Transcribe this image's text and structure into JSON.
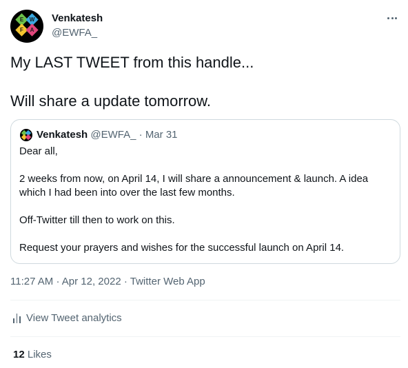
{
  "author": {
    "name": "Venkatesh",
    "handle": "@EWFA_",
    "avatar_letters": [
      "E",
      "W",
      "F",
      "A"
    ]
  },
  "tweet": {
    "lines": [
      "My LAST TWEET from this handle...",
      "Will share a update tomorrow."
    ]
  },
  "quoted_tweet": {
    "name": "Venkatesh",
    "handle": "@EWFA_",
    "separator": "·",
    "date": "Mar 31",
    "paragraphs": [
      "Dear all,",
      "2 weeks from now, on April 14, I will share a announcement & launch. A idea which I had been into over the last few months.",
      "Off-Twitter till then to work on this.",
      "Request your prayers and wishes for the successful launch on April 14."
    ]
  },
  "meta": {
    "time": "11:27 AM",
    "separator": "·",
    "date": "Apr 12, 2022",
    "source": "Twitter Web App"
  },
  "analytics": {
    "label": "View Tweet analytics"
  },
  "engagement": {
    "likes_count": "12",
    "likes_label": "Likes"
  },
  "colors": {
    "text": "#0f1419",
    "secondary": "#536471",
    "border": "#cfd9de",
    "divider": "#eff3f4"
  },
  "icons": {
    "more": "more-horizontal-icon",
    "analytics": "analytics-bars-icon"
  }
}
